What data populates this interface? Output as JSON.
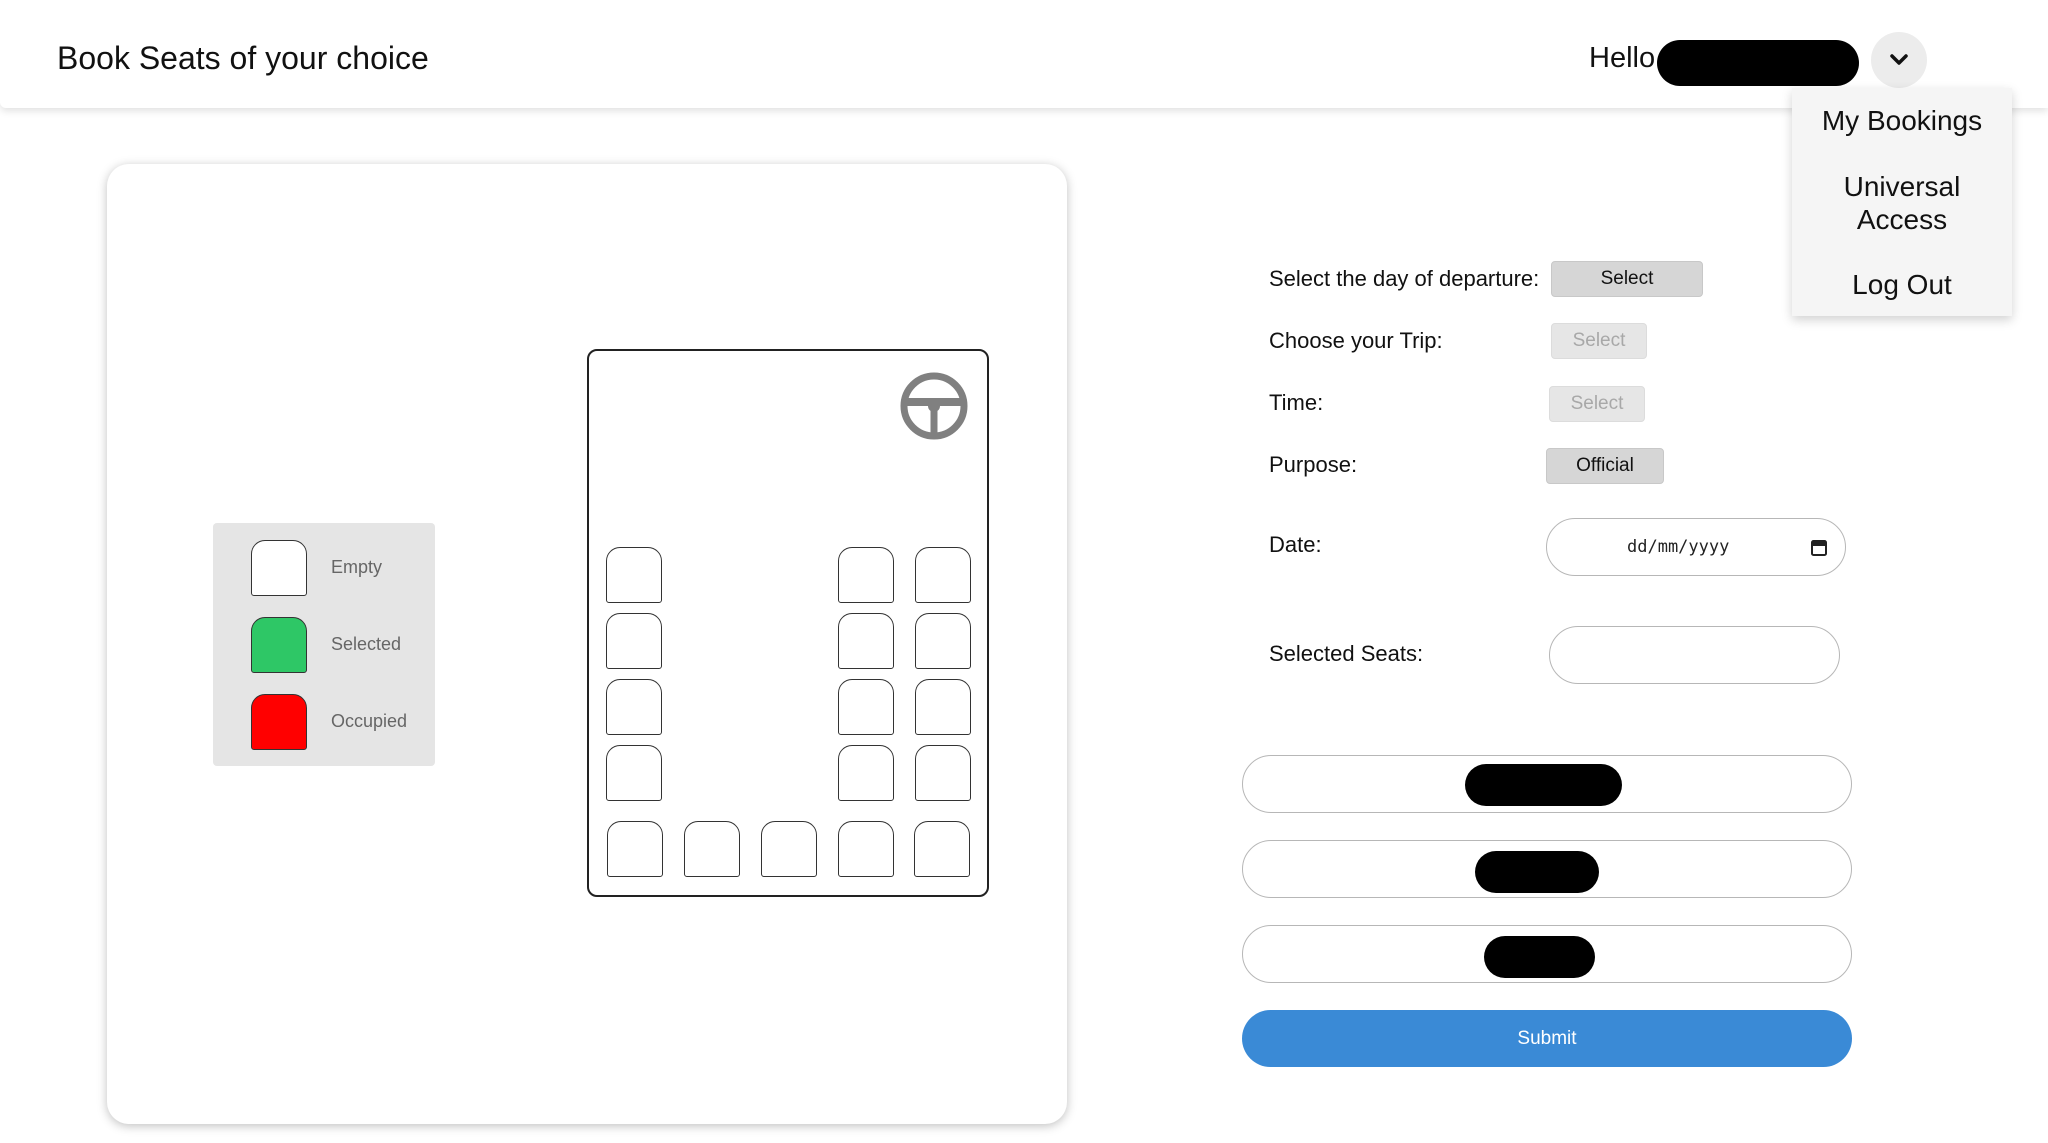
{
  "header": {
    "title": "Book Seats of your choice",
    "greeting": "Hello"
  },
  "menu": {
    "items": [
      "My Bookings",
      "Universal Access",
      "Log Out"
    ]
  },
  "legend": {
    "empty": "Empty",
    "selected": "Selected",
    "occupied": "Occupied",
    "colors": {
      "empty": "#ffffff",
      "selected": "#2ec766",
      "occupied": "#ff0000"
    }
  },
  "form": {
    "day_label": "Select the day of departure:",
    "day_value": "Select",
    "trip_label": "Choose your Trip:",
    "trip_value": "Select",
    "time_label": "Time:",
    "time_value": "Select",
    "purpose_label": "Purpose:",
    "purpose_value": "Official",
    "date_label": "Date:",
    "date_placeholder": "dd/mm/yyyy",
    "seats_label": "Selected Seats:",
    "seats_value": "",
    "submit_label": "Submit"
  },
  "colors": {
    "accent": "#3a8ad6",
    "wheel": "#808080"
  }
}
